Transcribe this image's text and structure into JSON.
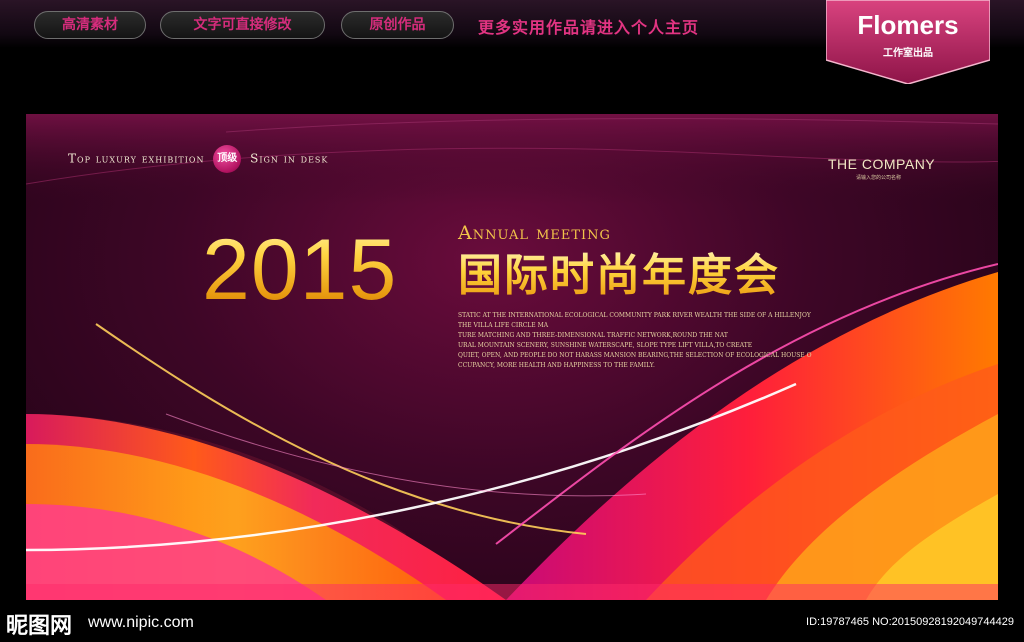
{
  "header": {
    "buttons": [
      "高清素材",
      "文字可直接修改",
      "原创作品"
    ],
    "promo": "更多实用作品请进入个人主页",
    "brand": {
      "name": "Flomers",
      "sub": "工作室出品"
    }
  },
  "banner": {
    "tagline_before": "Top luxury exhibition",
    "seal": "顶级",
    "tagline_after": "Sign in desk",
    "company": "THE COMPANY",
    "company_sub": "请输入您的公司名称",
    "year": "2015",
    "annual": "Annual meeting",
    "title_cn": "国际时尚年度会",
    "paragraph": [
      "STATIC AT THE INTERNATIONAL ECOLOGICAL COMMUNITY PARK RIVER WEALTH THE SIDE OF A HILLENJOY",
      "THE VILLA LIFE CIRCLE MA",
      "TURE MATCHING AND THREE-DIMENSIONAL TRAFFIC NETWORK,ROUND THE NAT",
      "URAL MOUNTAIN SCENERY, SUNSHINE WATERSCAPE, SLOPE TYPE LIFT VILLA,TO CREATE",
      "QUIET, OPEN, AND PEOPLE DO NOT HARASS MANSION BEARING,THE SELECTION OF ECOLOGICAL HOUSE O",
      "CCUPANCY, MORE HEALTH AND HAPPINESS TO THE FAMILY."
    ]
  },
  "footer": {
    "logo": "昵图网",
    "url": "www.nipic.com",
    "id": "ID:19787465 NO:20150928192049744429"
  },
  "colors": {
    "accent_pink": "#e23482",
    "banner_bg": "#3d0626",
    "gold": "#f0b821"
  }
}
